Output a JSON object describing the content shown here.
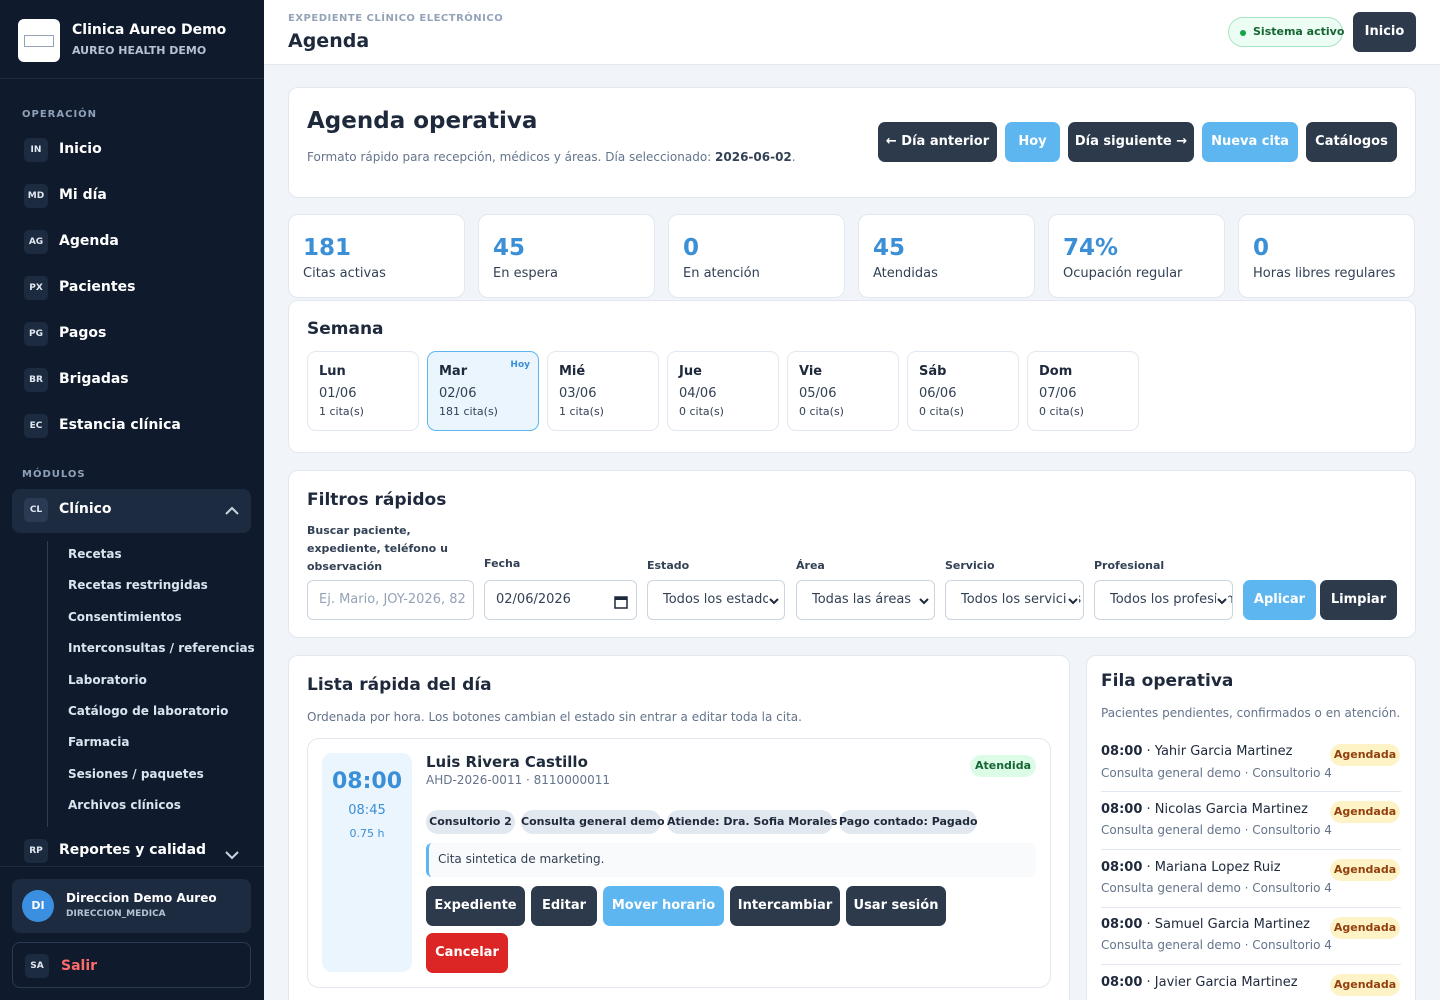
{
  "brand": {
    "title": "Clinica Aureo Demo",
    "subtitle": "AUREO HEALTH DEMO"
  },
  "sidebar": {
    "section_operation": "OPERACIÓN",
    "section_modules": "MÓDULOS",
    "items": [
      {
        "code": "IN",
        "label": "Inicio"
      },
      {
        "code": "MD",
        "label": "Mi día"
      },
      {
        "code": "AG",
        "label": "Agenda"
      },
      {
        "code": "PX",
        "label": "Pacientes"
      },
      {
        "code": "PG",
        "label": "Pagos"
      },
      {
        "code": "BR",
        "label": "Brigadas"
      },
      {
        "code": "EC",
        "label": "Estancia clínica"
      }
    ],
    "clinico": {
      "code": "CL",
      "label": "Clínico"
    },
    "sub_items": [
      "Recetas",
      "Recetas restringidas",
      "Consentimientos",
      "Interconsultas / referencias",
      "Laboratorio",
      "Catálogo de laboratorio",
      "Farmacia",
      "Sesiones / paquetes",
      "Archivos clínicos"
    ],
    "reportes": {
      "code": "RP",
      "label": "Reportes y calidad"
    },
    "user": {
      "initials": "DI",
      "name": "Direccion Demo Aureo",
      "role": "DIRECCION_MEDICA"
    },
    "logout": {
      "code": "SA",
      "label": "Salir"
    }
  },
  "topbar": {
    "eyebrow": "EXPEDIENTE CLÍNICO ELECTRÓNICO",
    "title": "Agenda",
    "status": "Sistema activo",
    "home_button": "Inicio"
  },
  "header": {
    "title": "Agenda operativa",
    "subtitle": "Formato rápido para recepción, médicos y áreas. Día seleccionado: ",
    "selected_date": "2026-06-02",
    "period": ".",
    "buttons": {
      "prev": "← Día anterior",
      "today": "Hoy",
      "next": "Día siguiente →",
      "new": "Nueva cita",
      "catalogs": "Catálogos"
    }
  },
  "stats": [
    {
      "value": "181",
      "label": "Citas activas"
    },
    {
      "value": "45",
      "label": "En espera"
    },
    {
      "value": "0",
      "label": "En atención"
    },
    {
      "value": "45",
      "label": "Atendidas"
    },
    {
      "value": "74%",
      "label": "Ocupación regular"
    },
    {
      "value": "0",
      "label": "Horas libres regulares"
    }
  ],
  "week": {
    "title": "Semana",
    "today_tag": "Hoy",
    "days": [
      {
        "name": "Lun",
        "date": "01/06",
        "count": "1 cita(s)"
      },
      {
        "name": "Mar",
        "date": "02/06",
        "count": "181 cita(s)"
      },
      {
        "name": "Mié",
        "date": "03/06",
        "count": "1 cita(s)"
      },
      {
        "name": "Jue",
        "date": "04/06",
        "count": "0 cita(s)"
      },
      {
        "name": "Vie",
        "date": "05/06",
        "count": "0 cita(s)"
      },
      {
        "name": "Sáb",
        "date": "06/06",
        "count": "0 cita(s)"
      },
      {
        "name": "Dom",
        "date": "07/06",
        "count": "0 cita(s)"
      }
    ]
  },
  "filters": {
    "title": "Filtros rápidos",
    "search_label_1": "Buscar paciente,",
    "search_label_2": "expediente, teléfono u",
    "search_label_3": "observación",
    "search_placeholder": "Ej. Mario, JOY-2026, 82",
    "date_label": "Fecha",
    "date_value": "02/06/2026",
    "state_label": "Estado",
    "state_value": "Todos los estados",
    "area_label": "Área",
    "area_value": "Todas las áreas",
    "service_label": "Servicio",
    "service_value": "Todos los servicios",
    "professional_label": "Profesional",
    "professional_value": "Todos los profesionales",
    "apply": "Aplicar",
    "clear": "Limpiar"
  },
  "list": {
    "title": "Lista rápida del día",
    "subtitle": "Ordenada por hora. Los botones cambian el estado sin entrar a editar toda la cita.",
    "appointment": {
      "start": "08:00",
      "end": "08:45",
      "duration": "0.75 h",
      "patient": "Luis Rivera Castillo",
      "meta": "AHD-2026-0011 · 8110000011",
      "status": "Atendida",
      "chips": [
        "Consultorio 2",
        "Consulta general demo",
        "Atiende: Dra. Sofia Morales",
        "Pago contado: Pagado"
      ],
      "note": "Cita sintetica de marketing.",
      "actions": {
        "record": "Expediente",
        "edit": "Editar",
        "move": "Mover horario",
        "swap": "Intercambiar",
        "session": "Usar sesión",
        "cancel": "Cancelar"
      }
    }
  },
  "queue": {
    "title": "Fila operativa",
    "subtitle": "Pacientes pendientes, confirmados o en atención.",
    "items": [
      {
        "time": "08:00",
        "name": " · Yahir Garcia Martinez",
        "detail": "Consulta general demo · Consultorio 4",
        "status": "Agendada"
      },
      {
        "time": "08:00",
        "name": " · Nicolas Garcia Martinez",
        "detail": "Consulta general demo · Consultorio 4",
        "status": "Agendada"
      },
      {
        "time": "08:00",
        "name": " · Mariana Lopez Ruiz",
        "detail": "Consulta general demo · Consultorio 4",
        "status": "Agendada"
      },
      {
        "time": "08:00",
        "name": " · Samuel Garcia Martinez",
        "detail": "Consulta general demo · Consultorio 4",
        "status": "Agendada"
      },
      {
        "time": "08:00",
        "name": " · Javier Garcia Martinez",
        "detail": "Consulta general demo · Consultorio 4",
        "status": "Agendada"
      }
    ]
  },
  "colors": {
    "sidebar": "#0f1b2d",
    "accent": "#5eb6f0",
    "dark_button": "#2d3a4c",
    "stat_value": "#3b8fd6",
    "danger": "#dc2626"
  }
}
